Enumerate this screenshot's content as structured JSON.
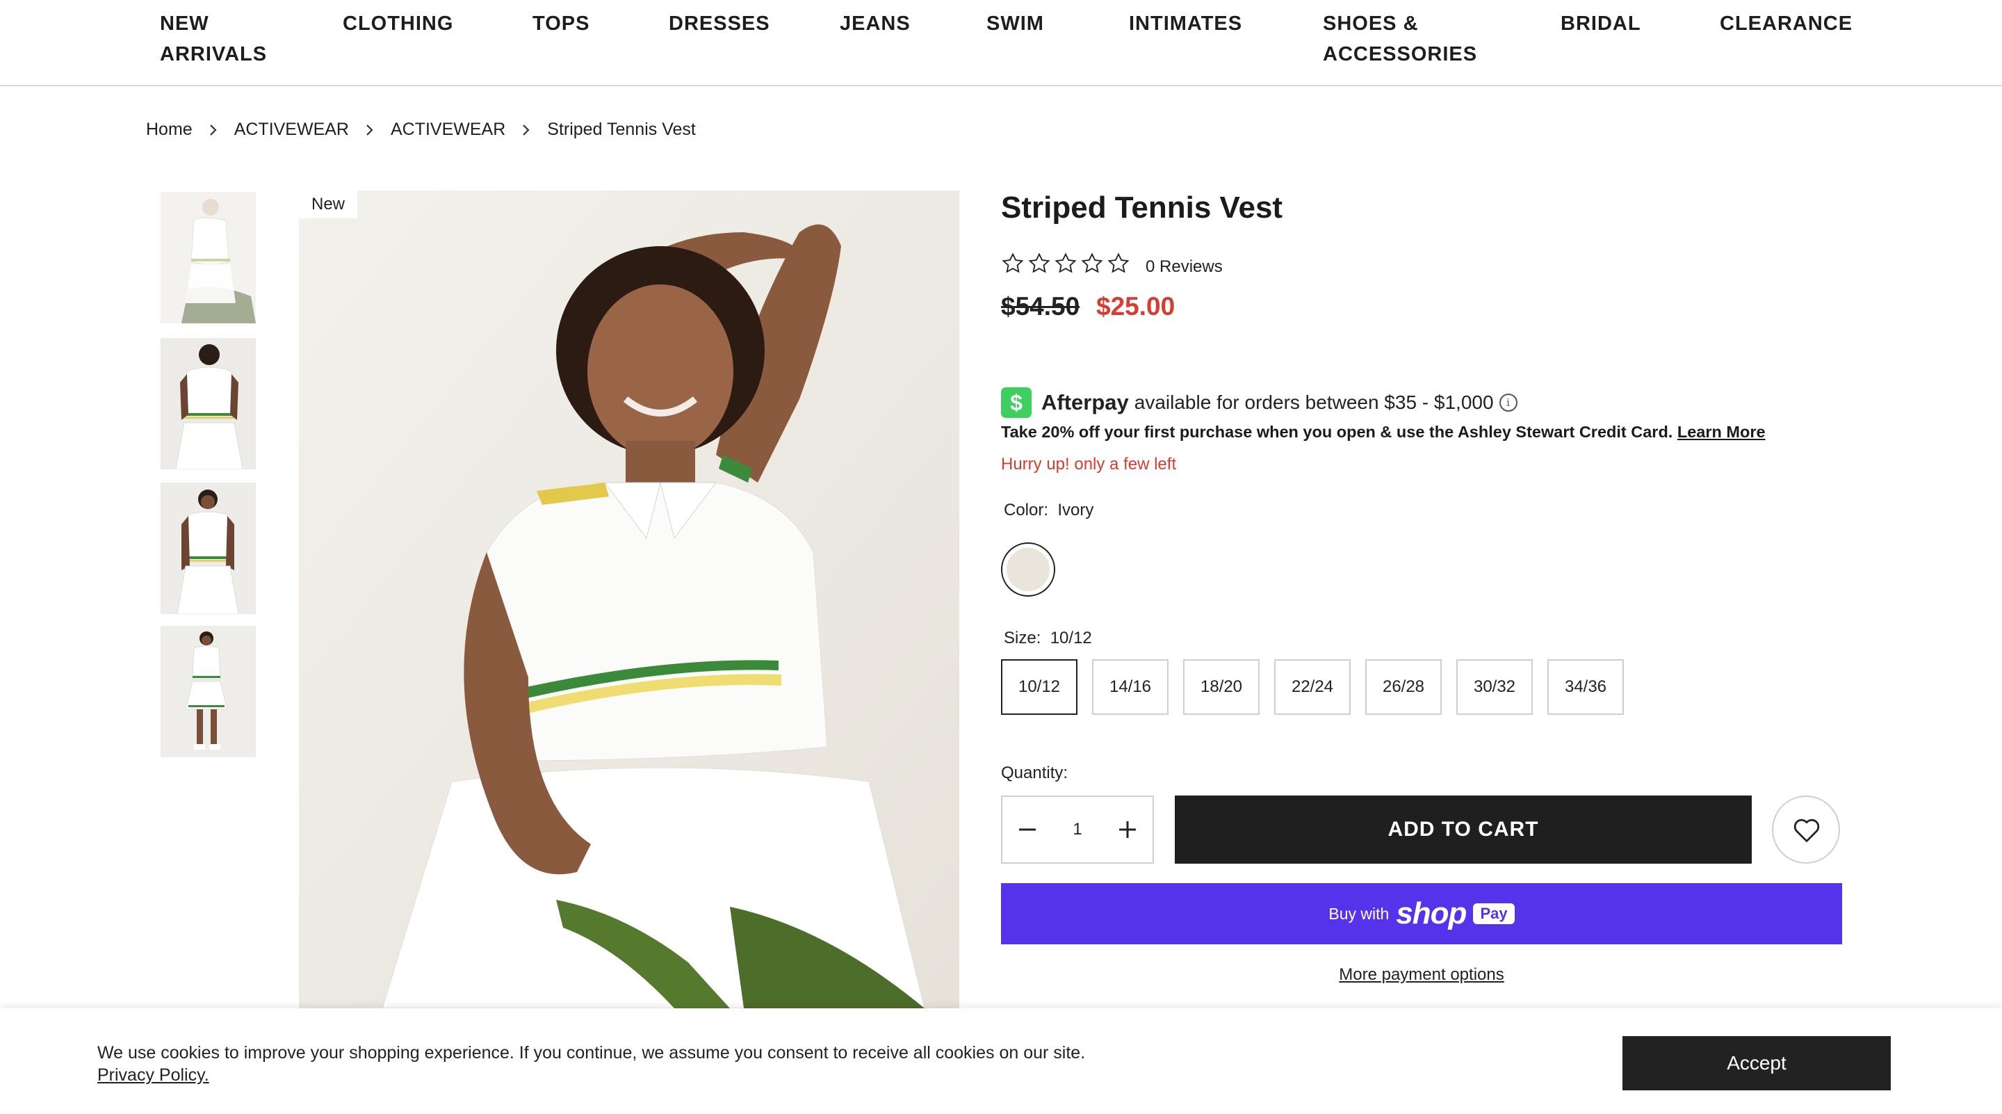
{
  "nav": {
    "items": [
      {
        "label": "NEW",
        "label2": "ARRIVALS"
      },
      {
        "label": "CLOTHING"
      },
      {
        "label": "TOPS"
      },
      {
        "label": "DRESSES"
      },
      {
        "label": "JEANS"
      },
      {
        "label": "SWIM"
      },
      {
        "label": "INTIMATES"
      },
      {
        "label": "SHOES &",
        "label2": "ACCESSORIES"
      },
      {
        "label": "BRIDAL"
      },
      {
        "label": "CLEARANCE"
      }
    ]
  },
  "breadcrumb": {
    "items": [
      "Home",
      "ACTIVEWEAR",
      "ACTIVEWEAR",
      "Striped Tennis Vest"
    ]
  },
  "gallery": {
    "badge": "New",
    "thumbnail_count": 4
  },
  "product": {
    "title": "Striped Tennis Vest",
    "rating": 0,
    "rating_max": 5,
    "reviews_label": "0 Reviews",
    "original_price": "$54.50",
    "sale_price": "$25.00",
    "sale_price_color": "#d83b2f"
  },
  "afterpay": {
    "logo_glyph": "$",
    "brand": "Afterpay",
    "text": "available for orders between $35 - $1,000",
    "info_glyph": "i",
    "logo_color": "#3ecf5e"
  },
  "promo": {
    "text": "Take 20% off your first purchase when you open & use the Ashley Stewart Credit Card.",
    "link": "Learn More"
  },
  "stock_message": "Hurry up! only a few left",
  "color": {
    "label": "Color:",
    "selected": "Ivory",
    "swatch_hex": "#e9e5da"
  },
  "size": {
    "label": "Size:",
    "selected": "10/12",
    "options": [
      "10/12",
      "14/16",
      "18/20",
      "22/24",
      "26/28",
      "30/32",
      "34/36"
    ]
  },
  "quantity": {
    "label": "Quantity:",
    "value": "1"
  },
  "buttons": {
    "add_to_cart": "ADD TO CART",
    "shop_pay_prefix": "Buy with",
    "shop_pay_brand": "shop",
    "shop_pay_badge": "Pay",
    "shop_pay_color": "#5433eb",
    "more_payment": "More payment options"
  },
  "cookie": {
    "text": "We use cookies to improve your shopping experience. If you continue, we assume you consent to receive all cookies on our site.",
    "link": "Privacy Policy.",
    "accept": "Accept"
  }
}
